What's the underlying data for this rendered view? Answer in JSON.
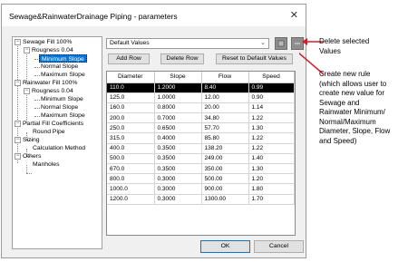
{
  "window": {
    "title": "Sewage&RainwaterDrainage Piping  - parameters",
    "close_glyph": "✕"
  },
  "tree": {
    "nodes": [
      {
        "label": "Sewage Fill 100%"
      },
      {
        "label": "Rougness 0.04"
      },
      {
        "label": "Minimum Slope"
      },
      {
        "label": "Normal Slope"
      },
      {
        "label": "Maximum Slope"
      },
      {
        "label": "Rainwater Fill 100%"
      },
      {
        "label": "Rougness 0.04"
      },
      {
        "label": "Minimum Slope"
      },
      {
        "label": "Normal Slope"
      },
      {
        "label": "Maximum Slope"
      },
      {
        "label": "Partial Fill Coefficients"
      },
      {
        "label": "Round Pipe"
      },
      {
        "label": "Sizing"
      },
      {
        "label": "Calculation Method"
      },
      {
        "label": "Others"
      },
      {
        "label": "Manholes"
      }
    ],
    "expand_glyph": "−"
  },
  "toolbar": {
    "combo_value": "Default Values",
    "combo_arrow": "⌄",
    "add_row": "Add Row",
    "delete_row": "Delete Row",
    "reset": "Reset to Default Values"
  },
  "table": {
    "headers": [
      "Diameter",
      "Slope",
      "Flow",
      "Speed"
    ],
    "rows": [
      [
        "110.0",
        "1.2000",
        "8.40",
        "0.99"
      ],
      [
        "125.0",
        "1.0000",
        "12.00",
        "0.90"
      ],
      [
        "160.0",
        "0.8000",
        "20.00",
        "1.14"
      ],
      [
        "200.0",
        "0.7000",
        "34.80",
        "1.22"
      ],
      [
        "250.0",
        "0.6500",
        "57.70",
        "1.30"
      ],
      [
        "315.0",
        "0.4000",
        "85.80",
        "1.22"
      ],
      [
        "400.0",
        "0.3500",
        "138.20",
        "1.22"
      ],
      [
        "500.0",
        "0.3500",
        "249.00",
        "1.40"
      ],
      [
        "670.0",
        "0.3500",
        "350.00",
        "1.30"
      ],
      [
        "800.0",
        "0.3000",
        "500.00",
        "1.20"
      ],
      [
        "1000.0",
        "0.3000",
        "900.00",
        "1.80"
      ],
      [
        "1200.0",
        "0.3000",
        "1300.00",
        "1.70"
      ]
    ]
  },
  "footer": {
    "ok": "OK",
    "cancel": "Cancel"
  },
  "annotations": {
    "delete_values": "Delete selected\nValues",
    "new_rule": "Create new rule\n(which allows user to\ncreate new value for\nSewage and\nRainwater Minimum/\nNormal/Maximum\nDiameter, Slope, Flow\nand Speed)"
  },
  "colors": {
    "annotation_arrow": "#d0202a",
    "selection": "#0078d7",
    "icon_button": "#8e8e8e"
  }
}
